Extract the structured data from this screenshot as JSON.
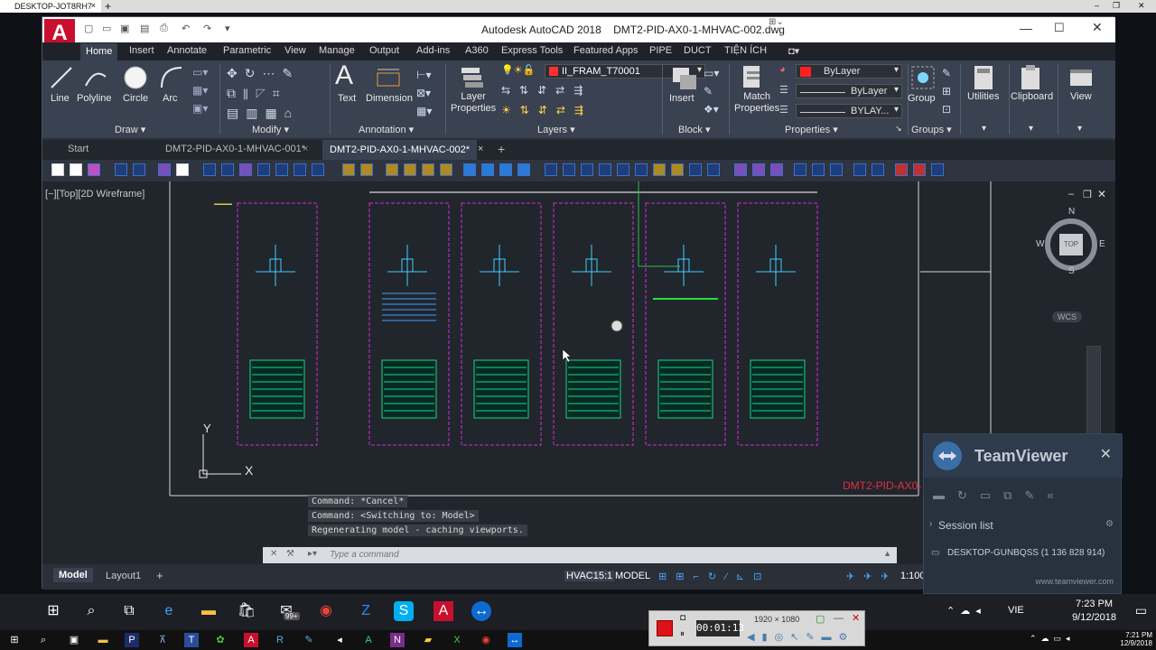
{
  "remote": {
    "tab_label": "DESKTOP-JOT8RH7",
    "close": "×",
    "add": "+"
  },
  "window": {
    "app_title": "Autodesk AutoCAD 2018",
    "file_title": "DMT2-PID-AX0-1-MHVAC-002.dwg",
    "logo": "A"
  },
  "ribbon_tabs": [
    "Home",
    "Insert",
    "Annotate",
    "Parametric",
    "View",
    "Manage",
    "Output",
    "Add-ins",
    "A360",
    "Express Tools",
    "Featured Apps",
    "PIPE",
    "DUCT",
    "TIỆN ÍCH"
  ],
  "ribbon": {
    "draw": {
      "label": "Draw",
      "line": "Line",
      "polyline": "Polyline",
      "circle": "Circle",
      "arc": "Arc"
    },
    "modify": {
      "label": "Modify"
    },
    "annotation": {
      "label": "Annotation",
      "text": "Text",
      "dimension": "Dimension"
    },
    "layers": {
      "label": "Layers",
      "layer_properties": "Layer\nProperties",
      "current_layer": "II_FRAM_T70001"
    },
    "block": {
      "label": "Block",
      "insert": "Insert"
    },
    "properties": {
      "label": "Properties",
      "match": "Match\nProperties",
      "color": "ByLayer",
      "linetype": "ByLayer",
      "lineweight": "BYLAY..."
    },
    "groups": {
      "label": "Groups",
      "group": "Group"
    },
    "utilities": "Utilities",
    "clipboard": "Clipboard",
    "view": "View"
  },
  "doc_tabs": {
    "start": "Start",
    "tab1": "DMT2-PID-AX0-1-MHVAC-001*",
    "tab2": "DMT2-PID-AX0-1-MHVAC-002*",
    "add": "+"
  },
  "viewport": {
    "label": "[−][Top][2D Wireframe]",
    "compass": {
      "n": "N",
      "s": "S",
      "e": "E",
      "w": "W",
      "top": "TOP",
      "wcs": "WCS"
    },
    "drawing_id": "DMT2-PID-AX0-",
    "ucs_x": "X",
    "ucs_y": "Y"
  },
  "command": {
    "history": [
      "Command: *Cancel*",
      "Command:   <Switching to: Model>",
      "Regenerating model - caching viewports."
    ],
    "placeholder": "Type a command"
  },
  "status": {
    "model_tab": "Model",
    "layout_tab": "Layout1",
    "add": "+",
    "hvac": "HVAC15:1",
    "model": "MODEL",
    "scale": "1:100"
  },
  "teamviewer": {
    "name": "TeamViewer",
    "session_list": "Session list",
    "item": "DESKTOP-GUNBQSS (1 136 828 914)",
    "url": "www.teamviewer.com"
  },
  "taskbar": {
    "lang": "VIE",
    "time": "7:23 PM",
    "date": "9/12/2018",
    "time_small": "7:21 PM",
    "date_small": "12/9/2018",
    "badge": "99+"
  },
  "recorder": {
    "elapsed": "00:01:13",
    "resolution": "1920 × 1080"
  }
}
